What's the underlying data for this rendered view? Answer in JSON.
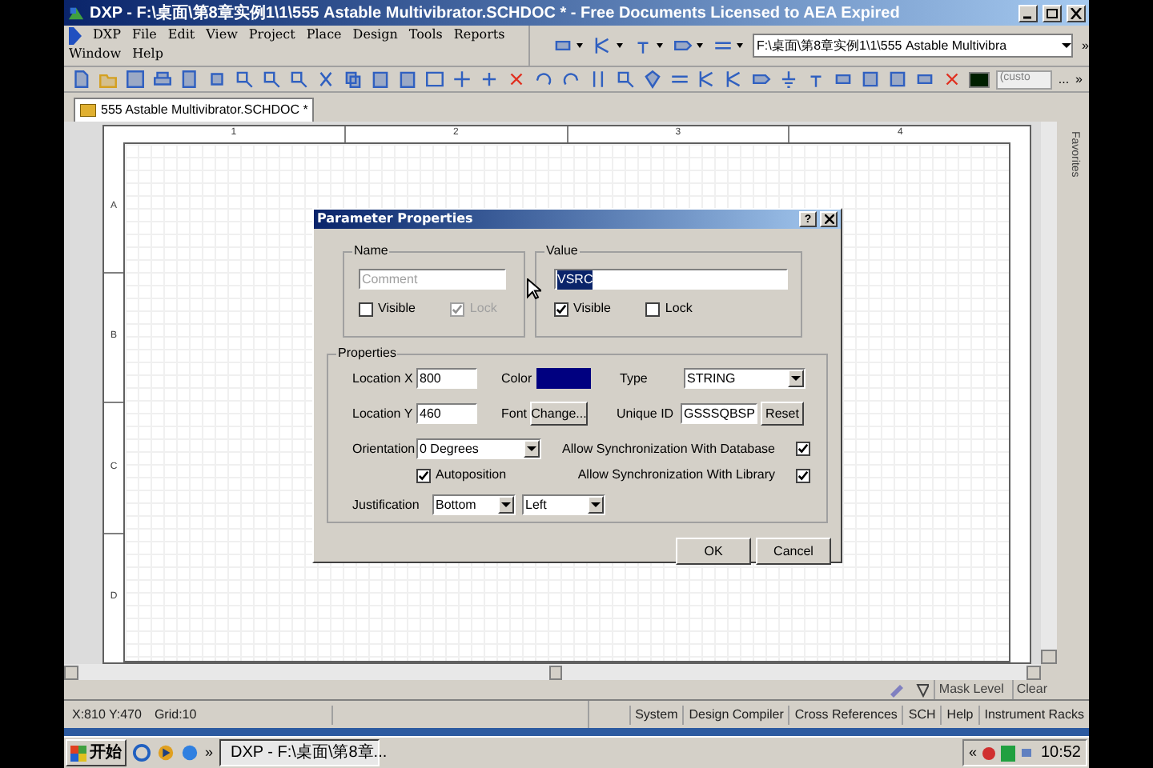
{
  "window": {
    "title": "DXP - F:\\桌面\\第8章实例1\\1\\555 Astable Multivibrator.SCHDOC * - Free Documents  Licensed to AEA Expired"
  },
  "menu": [
    "DXP",
    "File",
    "Edit",
    "View",
    "Project",
    "Place",
    "Design",
    "Tools",
    "Reports",
    "Window",
    "Help"
  ],
  "path_combo": {
    "value": "F:\\桌面\\第8章实例1\\1\\555 Astable Multivibra"
  },
  "color_combo": {
    "value": "(custo",
    "more": "..."
  },
  "overflow_chevrons": [
    "»",
    "»"
  ],
  "document_tab": {
    "label": "555 Astable Multivibrator.SCHDOC *"
  },
  "favorites_panel": {
    "label": "Favorites"
  },
  "sheet": {
    "columns": [
      "1",
      "2",
      "3",
      "4"
    ],
    "rows": [
      "A",
      "B",
      "C",
      "D"
    ]
  },
  "dialog": {
    "title": "Parameter Properties",
    "help": "?",
    "name_group": {
      "label": "Name",
      "value": "Comment",
      "visible": {
        "label": "Visible",
        "checked": false,
        "disabled": false
      },
      "lock": {
        "label": "Lock",
        "checked": true,
        "disabled": true
      }
    },
    "value_group": {
      "label": "Value",
      "value": "VSRC",
      "visible": {
        "label": "Visible",
        "checked": true,
        "disabled": false
      },
      "lock": {
        "label": "Lock",
        "checked": false,
        "disabled": false
      }
    },
    "properties": {
      "label": "Properties",
      "location_x": {
        "label": "Location X",
        "value": "800"
      },
      "location_y": {
        "label": "Location Y",
        "value": "460"
      },
      "color": {
        "label": "Color",
        "color": "#000080"
      },
      "font": {
        "label": "Font",
        "button": "Change..."
      },
      "type": {
        "label": "Type",
        "value": "STRING"
      },
      "unique_id": {
        "label": "Unique ID",
        "value": "GSSSQBSP",
        "button": "Reset"
      },
      "orientation": {
        "label": "Orientation",
        "value": "0 Degrees"
      },
      "autoposition": {
        "label": "Autoposition",
        "checked": true
      },
      "sync_database": {
        "label": "Allow Synchronization With Database",
        "checked": true
      },
      "sync_library": {
        "label": "Allow Synchronization With Library",
        "checked": true
      },
      "justification": {
        "label": "Justification",
        "vertical": "Bottom",
        "horizontal": "Left"
      }
    },
    "buttons": [
      "OK",
      "Cancel"
    ]
  },
  "mask_bar": {
    "mask_level": "Mask Level",
    "clear": "Clear"
  },
  "status_bar": {
    "coords": "X:810 Y:470",
    "grid": "Grid:10",
    "panels": [
      "System",
      "Design Compiler",
      "Cross References",
      "SCH",
      "Help",
      "Instrument Racks"
    ]
  },
  "taskbar": {
    "start": "开始",
    "chevron": "»",
    "task": "DXP - F:\\桌面\\第8章...",
    "tray_chevron": "«",
    "clock": "10:52"
  }
}
